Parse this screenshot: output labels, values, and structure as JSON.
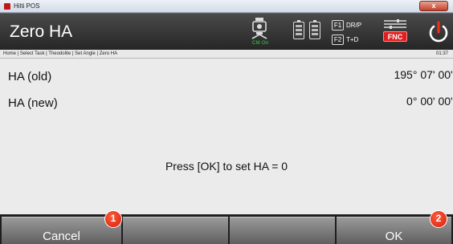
{
  "window": {
    "title": "Hilti POS",
    "close_label": "x"
  },
  "header": {
    "title": "Zero HA",
    "theodolite_status": "CM On",
    "fkeys": [
      {
        "key": "F1",
        "label": "DR/P"
      },
      {
        "key": "F2",
        "label": "T+D"
      }
    ],
    "fnc_label": "FNC"
  },
  "breadcrumb": {
    "path": "Home | Select Task | Theodolite | Set Angle | Zero HA",
    "time": "01:37"
  },
  "fields": [
    {
      "label": "HA (old)",
      "value": "195° 07' 00\""
    },
    {
      "label": "HA (new)",
      "value": "0° 00' 00\""
    }
  ],
  "message": "Press [OK] to set HA = 0",
  "buttons": {
    "cancel": "Cancel",
    "ok": "OK"
  },
  "markers": {
    "cancel": "1",
    "ok": "2"
  },
  "colors": {
    "accent_red": "#e02020",
    "status_green": "#39d33f",
    "header_bg": "#333333",
    "content_bg": "#ebebeb"
  }
}
